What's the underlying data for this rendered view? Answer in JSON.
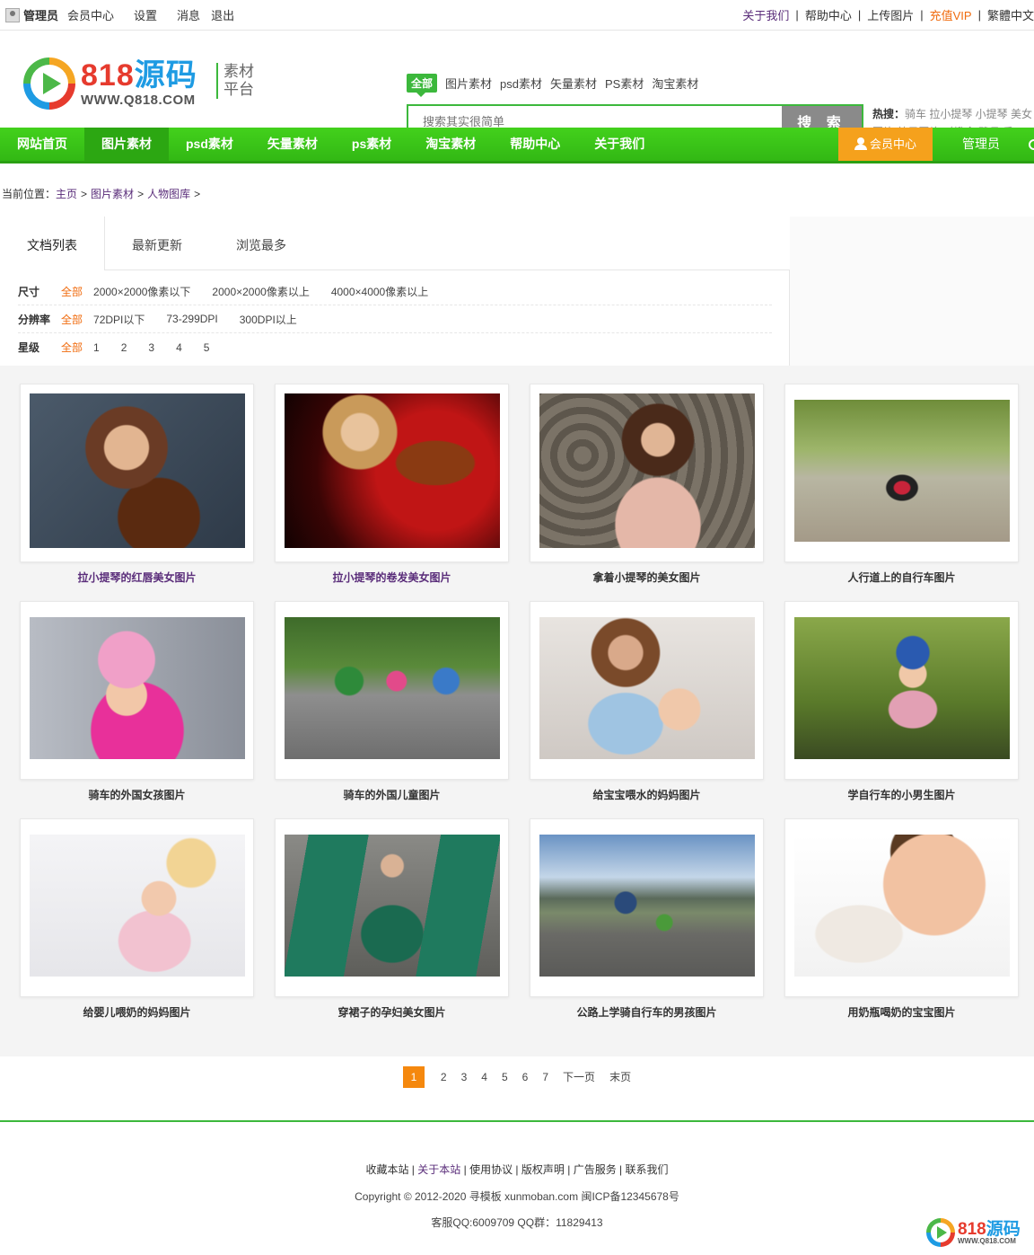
{
  "topbar": {
    "user": "管理员",
    "links_left": [
      "会员中心",
      "设置",
      "消息",
      "退出"
    ],
    "about": "关于我们",
    "help": "帮助中心",
    "upload": "上传图片",
    "vip": "充值VIP",
    "lang": "繁體中文"
  },
  "logo": {
    "num": "818",
    "name": "源码",
    "url": "WWW.Q818.COM",
    "sub1": "素材",
    "sub2": "平台"
  },
  "search": {
    "tabs": [
      "全部",
      "图片素材",
      "psd素材",
      "矢量素材",
      "PS素材",
      "淘宝素材"
    ],
    "placeholder": "搜索其实很简单",
    "button": "搜 索",
    "hot_label": "热搜：",
    "hot_terms": "骑车 拉小提琴 小提琴 美女图片 效果图片 对掀盒 雅月 香"
  },
  "nav": {
    "items": [
      "网站首页",
      "图片素材",
      "psd素材",
      "矢量素材",
      "ps素材",
      "淘宝素材",
      "帮助中心",
      "关于我们"
    ],
    "member": "会员中心",
    "admin": "管理员"
  },
  "breadcrumb": {
    "prefix": "当前位置：",
    "items": [
      "主页",
      "图片素材",
      "人物图库"
    ]
  },
  "tabs": [
    "文档列表",
    "最新更新",
    "浏览最多"
  ],
  "filters": {
    "size_label": "尺寸",
    "size_opts": [
      "全部",
      "2000×2000像素以下",
      "2000×2000像素以上",
      "4000×4000像素以上"
    ],
    "dpi_label": "分辨率",
    "dpi_opts": [
      "全部",
      "72DPI以下",
      "73-299DPI",
      "300DPI以上"
    ],
    "star_label": "星级",
    "star_opts": [
      "全部",
      "1",
      "2",
      "3",
      "4",
      "5"
    ]
  },
  "items": [
    "拉小提琴的红唇美女图片",
    "拉小提琴的卷发美女图片",
    "拿着小提琴的美女图片",
    "人行道上的自行车图片",
    "骑车的外国女孩图片",
    "骑车的外国儿童图片",
    "给宝宝喂水的妈妈图片",
    "学自行车的小男生图片",
    "给婴儿喂奶的妈妈图片",
    "穿裙子的孕妇美女图片",
    "公路上学骑自行车的男孩图片",
    "用奶瓶喝奶的宝宝图片"
  ],
  "pager": {
    "pages": [
      "1",
      "2",
      "3",
      "4",
      "5",
      "6",
      "7"
    ],
    "next": "下一页",
    "last": "末页"
  },
  "footer": {
    "links": [
      "收藏本站",
      "关于本站",
      "使用协议",
      "版权声明",
      "广告服务",
      "联系我们"
    ],
    "copyright": "Copyright © 2012-2020 寻模板 xunmoban.com 闽ICP备12345678号",
    "contact": "客服QQ:6009709 QQ群：11829413"
  },
  "colors": {
    "brand_green": "#3cb83c",
    "accent_orange": "#f5880e",
    "link_purple": "#5a2d7a"
  }
}
